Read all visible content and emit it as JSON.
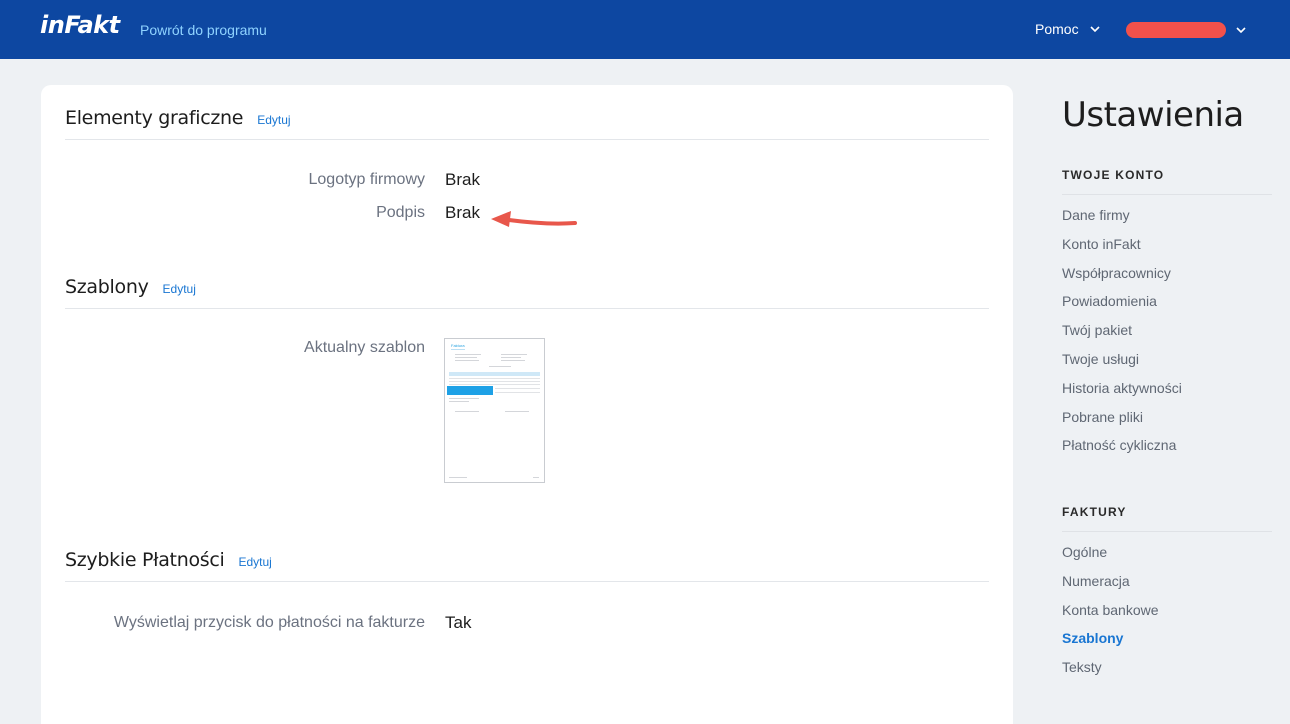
{
  "header": {
    "logo": "inFakt",
    "back_link": "Powrót do programu",
    "help_label": "Pomoc"
  },
  "sections": {
    "graphics": {
      "title": "Elementy graficzne",
      "edit": "Edytuj",
      "rows": [
        {
          "label": "Logotyp firmowy",
          "value": "Brak"
        },
        {
          "label": "Podpis",
          "value": "Brak"
        }
      ]
    },
    "templates": {
      "title": "Szablony",
      "edit": "Edytuj",
      "current_label": "Aktualny szablon",
      "thumb_title": "Faktura"
    },
    "payments": {
      "title": "Szybkie Płatności",
      "edit": "Edytuj",
      "rows": [
        {
          "label": "Wyświetlaj przycisk do płatności na fakturze",
          "value": "Tak"
        }
      ]
    }
  },
  "sidebar": {
    "title": "Ustawienia",
    "account": {
      "heading": "TWOJE KONTO",
      "items": [
        "Dane firmy",
        "Konto inFakt",
        "Współpracownicy",
        "Powiadomienia",
        "Twój pakiet",
        "Twoje usługi",
        "Historia aktywności",
        "Pobrane pliki",
        "Płatność cykliczna"
      ]
    },
    "invoices": {
      "heading": "FAKTURY",
      "items": [
        "Ogólne",
        "Numeracja",
        "Konta bankowe",
        "Szablony",
        "Teksty"
      ],
      "active": "Szablony"
    }
  },
  "colors": {
    "topbar": "#0d47a1",
    "accent": "#1976d2",
    "annotation_arrow": "#e8574b"
  }
}
